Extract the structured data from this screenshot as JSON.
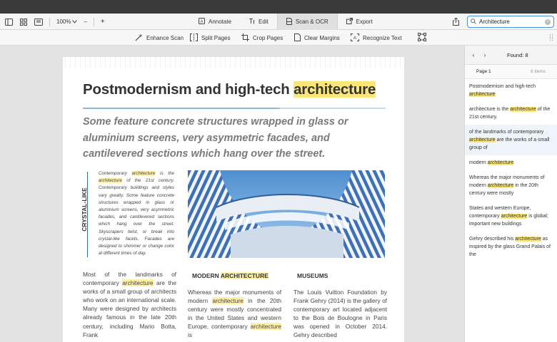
{
  "toolbar": {
    "zoom": "100%",
    "zoom_minus": "–",
    "zoom_plus": "+",
    "tabs": [
      {
        "label": "Annotate",
        "icon": "annotate-icon"
      },
      {
        "label": "Edit",
        "icon": "edit-text-icon"
      },
      {
        "label": "Scan & OCR",
        "icon": "scan-icon",
        "active": true
      },
      {
        "label": "Export",
        "icon": "export-icon"
      }
    ],
    "search_value": "Architecture"
  },
  "subbar": {
    "tools": [
      "Enhance Scan",
      "Split Pages",
      "Crop Pages",
      "Clear Margins",
      "Recognize Text"
    ]
  },
  "document": {
    "title_plain": "Postmodernism  and high-tech ",
    "title_highlight": "architecture",
    "subtitle": "Some feature concrete structures wrapped in glass  or aluminium screens, very asymmetric facades, and cantilevered sections which hang over the street.",
    "side_label": "CRYSTAL-LIKE",
    "intro": {
      "p1": "Contemporary ",
      "h1": "architecture",
      "p2": " is the ",
      "h2": "architecture",
      "p3": " of the 21st century. Contemporary buildings and styles vary greatly. Some feature concrete structures wrapped in glass or aluminium screens, very asymmetric facades, and cantilevered sections which hang over the street. Skyscrapers twist, or break into crystal-like facets. Facades are designed to shimmer or change color at different times of day."
    },
    "col1": {
      "p1": "Most of the landmarks of contemporary ",
      "h1": "architecture",
      "p2": " are the works of a small group of architects who work on an international scale. Many were designed by architects already famous in the late 20th century, including Mario Botta, Frank"
    },
    "col2": {
      "heading_plain": "MODERN ",
      "heading_highlight": "ARCHITECTURE",
      "p1": "Whereas the major monuments of modern ",
      "h1": "architecture",
      "p2": " in the 20th century were mostly concentrated in the United States and western Europe, contemporary ",
      "h2": "architecture",
      "p3": " is"
    },
    "col3": {
      "heading": "MUSEUMS",
      "text": "The Louis Vuitton Foundation by Frank Gehry (2014) is the gallery of contemporary art located adjacent to the Bois de Boulogne in Paris was opened in October 2014. Gehry described"
    }
  },
  "panel": {
    "prev": "‹",
    "next": "›",
    "found": "Found: 8",
    "page_label": "Page 1",
    "page_count": "8 items",
    "results": [
      {
        "before": "Postmodernism and high-tech ",
        "match": "architecture",
        "after": ""
      },
      {
        "before": "architecture is the ",
        "match": "architecture",
        "after": " of the 21st century."
      },
      {
        "before": "of the landmarks of contemporary ",
        "match": "architecture",
        "after": " are the works of a small group of"
      },
      {
        "before": "modern ",
        "match": "architecture",
        "after": ""
      },
      {
        "before": "Whereas the major monuments of modern ",
        "match": "architecture",
        "after": " in the 20th century were mostly"
      },
      {
        "before": "States and western Europe, contemporary ",
        "match": "architecture",
        "after": " is global; important new buildings"
      },
      {
        "before": "Gehry described his ",
        "match": "architecture",
        "after": " as inspired by the glass Grand Palais of the"
      }
    ]
  },
  "colors": {
    "highlight": "#fbe67a",
    "accent": "#4a90e2",
    "titlebar": "#3a3a3a"
  }
}
